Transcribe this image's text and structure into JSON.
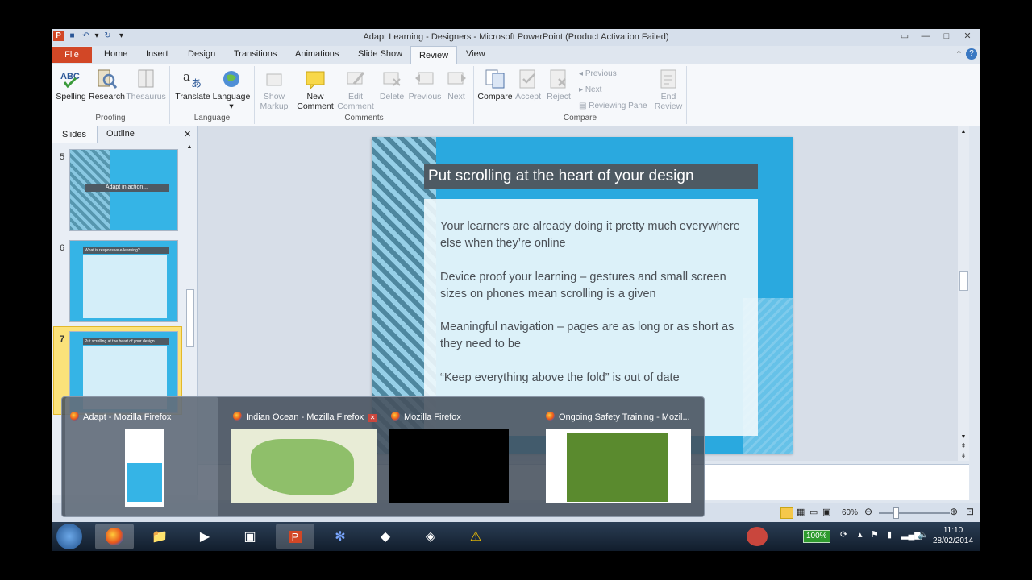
{
  "window": {
    "title": "Adapt Learning - Designers - Microsoft PowerPoint (Product Activation Failed)"
  },
  "tabs": [
    "File",
    "Home",
    "Insert",
    "Design",
    "Transitions",
    "Animations",
    "Slide Show",
    "Review",
    "View"
  ],
  "active_tab": "Review",
  "ribbon": {
    "proofing": {
      "label": "Proofing",
      "spelling": "Spelling",
      "research": "Research",
      "thesaurus": "Thesaurus"
    },
    "language": {
      "label": "Language",
      "translate": "Translate",
      "language": "Language"
    },
    "comments": {
      "label": "Comments",
      "show_markup_1": "Show",
      "show_markup_2": "Markup",
      "new_comment_1": "New",
      "new_comment_2": "Comment",
      "edit_comment_1": "Edit",
      "edit_comment_2": "Comment",
      "delete": "Delete",
      "previous": "Previous",
      "next": "Next"
    },
    "compare": {
      "label": "Compare",
      "compare": "Compare",
      "accept": "Accept",
      "reject": "Reject",
      "previous": "Previous",
      "next": "Next",
      "reviewing_pane": "Reviewing Pane",
      "end_review_1": "End",
      "end_review_2": "Review"
    }
  },
  "left_pane": {
    "tab_slides": "Slides",
    "tab_outline": "Outline",
    "thumbs": [
      {
        "num": "5",
        "caption": "Adapt in action..."
      },
      {
        "num": "6",
        "caption": "What is responsive e-learning?"
      },
      {
        "num": "7",
        "caption": "Put scrolling at the heart of your design"
      }
    ]
  },
  "slide": {
    "title": "Put scrolling at the heart of your design",
    "bullets": [
      "Your learners are already doing it pretty much everywhere else when they’re online",
      "Device proof your learning – gestures and small screen sizes on phones mean scrolling is a given",
      "Meaningful navigation – pages are as long or as short as they need to be",
      "“Keep everything above the fold” is out of date"
    ]
  },
  "status": {
    "zoom": "60%"
  },
  "peek": [
    {
      "title": "Adapt - Mozilla Firefox"
    },
    {
      "title": "Indian Ocean - Mozilla Firefox"
    },
    {
      "title": "Mozilla Firefox"
    },
    {
      "title": "Ongoing Safety Training - Mozil..."
    }
  ],
  "tray": {
    "battery": "100%",
    "time": "11:10",
    "date": "28/02/2014"
  },
  "colors": {
    "file_tab": "#d24726",
    "slide_bg": "#2aa9df",
    "title_band": "#4e5a63"
  }
}
